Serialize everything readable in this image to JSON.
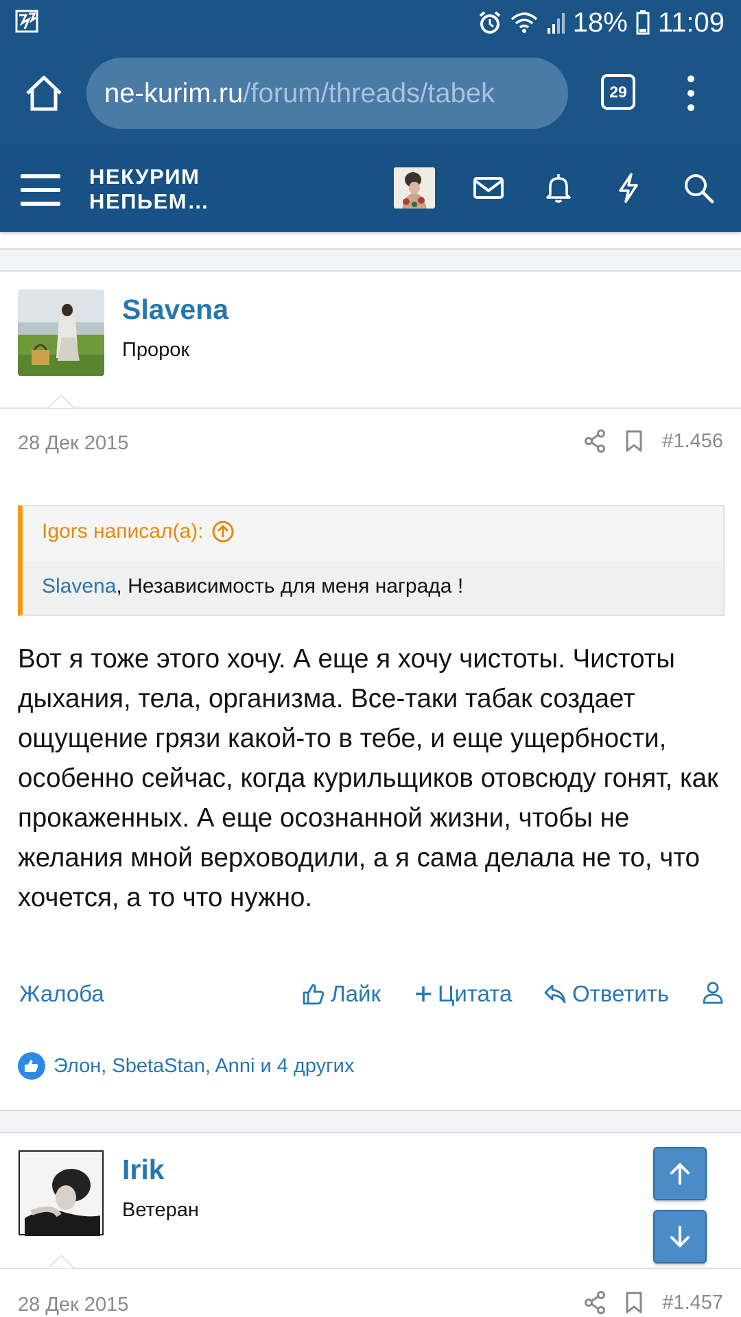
{
  "status_bar": {
    "battery": "18%",
    "time": "11:09"
  },
  "browser": {
    "url_host": "ne-kurim.ru",
    "url_path": "/forum/threads/tabek",
    "tab_count": "29"
  },
  "site": {
    "logo_line1": "НЕКУРИМ",
    "logo_line2": "НЕПЬЕМ…"
  },
  "post1": {
    "username": "Slavena",
    "user_title": "Пророк",
    "date": "28 Дек 2015",
    "post_number": "#1.456",
    "quote": {
      "author_line": "Igors написал(а):",
      "mention": "Slavena",
      "text": ", Независимость для меня награда !"
    },
    "body": "Вот я тоже этого хочу. А еще я хочу чистоты. Чистоты дыхания, тела, организма. Все-таки табак создает ощущение грязи какой-то в тебе, и еще ущербности, особенно сейчас, когда курильщиков отовсюду гонят, как прокаженных. А еще осознанной жизни, чтобы не желания мной верховодили, а я сама делала не то, что хочется, а то что нужно.",
    "actions": {
      "report": "Жалоба",
      "like": "Лайк",
      "quote": "Цитата",
      "reply": "Ответить"
    },
    "likes_text": "Элон, SbetaStan, Anni и 4 других"
  },
  "post2": {
    "username": "Irik",
    "user_title": "Ветеран",
    "date": "28 Дек 2015",
    "post_number": "#1.457"
  }
}
